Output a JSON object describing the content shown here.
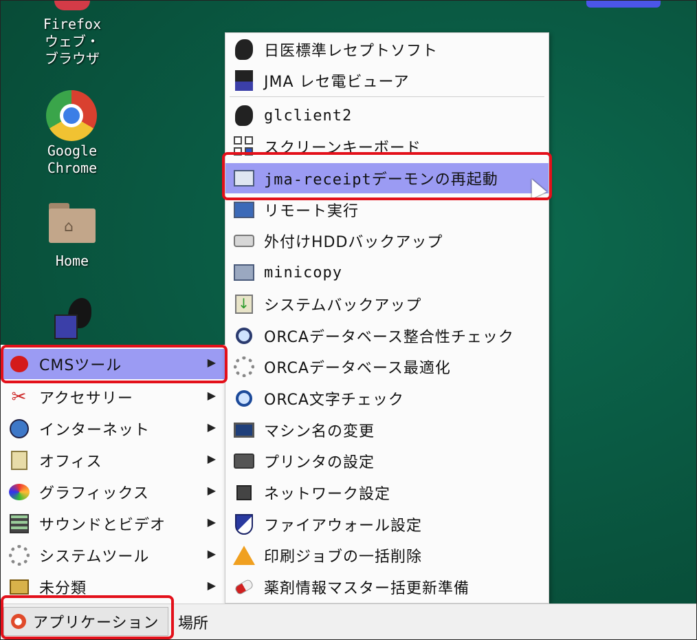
{
  "desktop": {
    "firefox_label": "Firefox\nウェブ・\nブラウザ",
    "chrome_label": "Google\nChrome",
    "home_label": "Home"
  },
  "main_menu": {
    "items": [
      {
        "label": "CMSツール",
        "icon": "apple-icon"
      },
      {
        "label": "アクセサリー",
        "icon": "accessories-icon"
      },
      {
        "label": "インターネット",
        "icon": "globe-icon"
      },
      {
        "label": "オフィス",
        "icon": "office-icon"
      },
      {
        "label": "グラフィックス",
        "icon": "palette-icon"
      },
      {
        "label": "サウンドとビデオ",
        "icon": "film-icon"
      },
      {
        "label": "システムツール",
        "icon": "gear-icon"
      },
      {
        "label": "未分類",
        "icon": "misc-icon"
      }
    ],
    "arrow": "▶"
  },
  "submenu": {
    "items": [
      {
        "label": "日医標準レセプトソフト"
      },
      {
        "label": "JMA レセ電ビューア"
      },
      {
        "label": "glclient2"
      },
      {
        "label": "スクリーンキーボード"
      },
      {
        "label": "jma-receiptデーモンの再起動"
      },
      {
        "label": "リモート実行"
      },
      {
        "label": "外付けHDDバックアップ"
      },
      {
        "label": "minicopy"
      },
      {
        "label": "システムバックアップ"
      },
      {
        "label": "ORCAデータベース整合性チェック"
      },
      {
        "label": "ORCAデータベース最適化"
      },
      {
        "label": "ORCA文字チェック"
      },
      {
        "label": "マシン名の変更"
      },
      {
        "label": "プリンタの設定"
      },
      {
        "label": "ネットワーク設定"
      },
      {
        "label": "ファイアウォール設定"
      },
      {
        "label": "印刷ジョブの一括削除"
      },
      {
        "label": "薬剤情報マスター括更新準備"
      }
    ]
  },
  "panel": {
    "applications_label": "アプリケーション",
    "places_label": "場所"
  },
  "colors": {
    "highlight": "#9b9bf3",
    "annotation_red": "#e3101a",
    "desktop_green": "#0a5a43"
  }
}
